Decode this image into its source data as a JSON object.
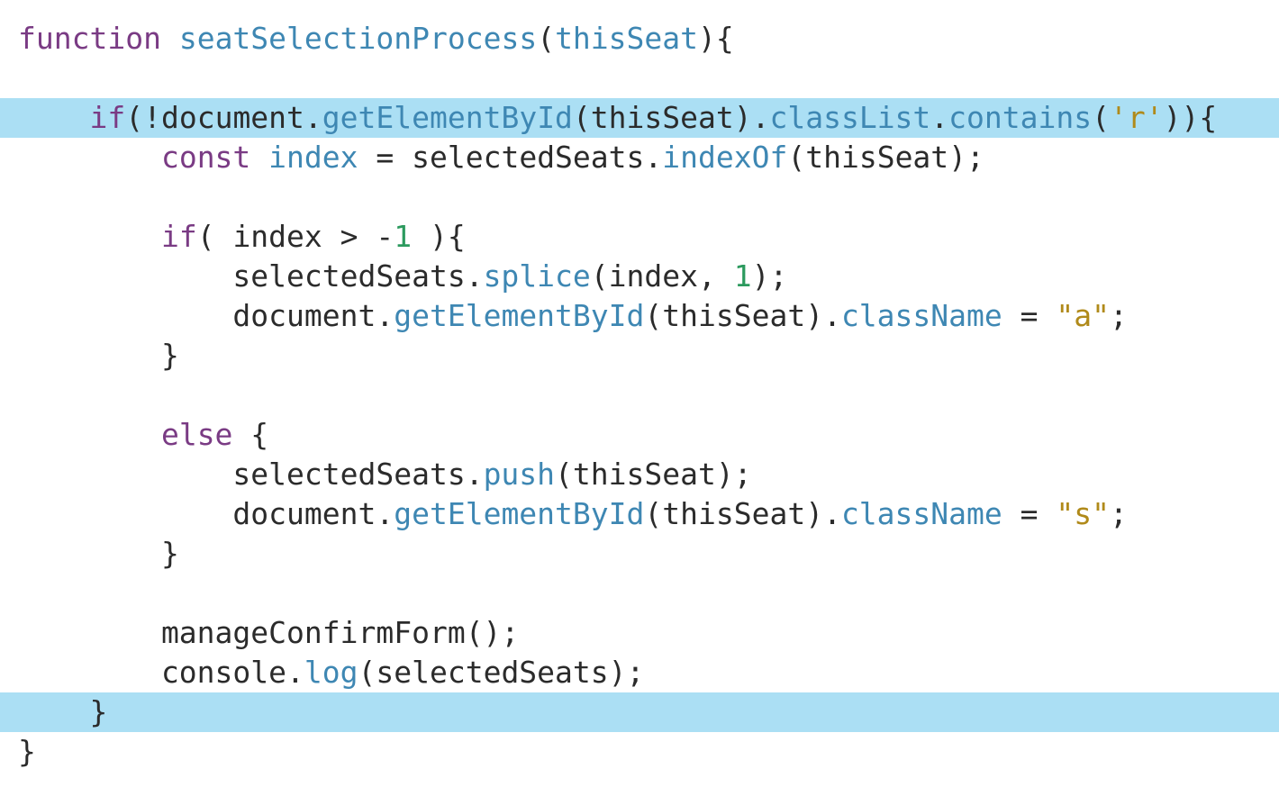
{
  "editor": {
    "colors": {
      "background": "#ffffff",
      "highlight": "#abdff4",
      "keyword": "#7a3b84",
      "method": "#3e87b3",
      "plain": "#2b2b2b",
      "string": "#b08a1a",
      "number": "#2c9a5e"
    },
    "lines": [
      {
        "highlighted": false,
        "tokens": [
          {
            "t": "keyword",
            "v": "function"
          },
          {
            "t": "plain",
            "v": " "
          },
          {
            "t": "method",
            "v": "seatSelectionProcess"
          },
          {
            "t": "plain",
            "v": "("
          },
          {
            "t": "method",
            "v": "thisSeat"
          },
          {
            "t": "plain",
            "v": "){"
          }
        ]
      },
      {
        "highlighted": false,
        "tokens": []
      },
      {
        "highlighted": true,
        "tokens": [
          {
            "t": "plain",
            "v": "    "
          },
          {
            "t": "keyword",
            "v": "if"
          },
          {
            "t": "plain",
            "v": "(!document."
          },
          {
            "t": "method",
            "v": "getElementById"
          },
          {
            "t": "plain",
            "v": "(thisSeat)."
          },
          {
            "t": "method",
            "v": "classList"
          },
          {
            "t": "plain",
            "v": "."
          },
          {
            "t": "method",
            "v": "contains"
          },
          {
            "t": "plain",
            "v": "("
          },
          {
            "t": "string",
            "v": "'r'"
          },
          {
            "t": "plain",
            "v": ")){"
          }
        ]
      },
      {
        "highlighted": false,
        "tokens": [
          {
            "t": "plain",
            "v": "        "
          },
          {
            "t": "keyword",
            "v": "const"
          },
          {
            "t": "plain",
            "v": " "
          },
          {
            "t": "method",
            "v": "index"
          },
          {
            "t": "plain",
            "v": " = selectedSeats."
          },
          {
            "t": "method",
            "v": "indexOf"
          },
          {
            "t": "plain",
            "v": "(thisSeat);"
          }
        ]
      },
      {
        "highlighted": false,
        "tokens": []
      },
      {
        "highlighted": false,
        "tokens": [
          {
            "t": "plain",
            "v": "        "
          },
          {
            "t": "keyword",
            "v": "if"
          },
          {
            "t": "plain",
            "v": "( index > -"
          },
          {
            "t": "number",
            "v": "1"
          },
          {
            "t": "plain",
            "v": " ){"
          }
        ]
      },
      {
        "highlighted": false,
        "tokens": [
          {
            "t": "plain",
            "v": "            selectedSeats."
          },
          {
            "t": "method",
            "v": "splice"
          },
          {
            "t": "plain",
            "v": "(index, "
          },
          {
            "t": "number",
            "v": "1"
          },
          {
            "t": "plain",
            "v": ");"
          }
        ]
      },
      {
        "highlighted": false,
        "tokens": [
          {
            "t": "plain",
            "v": "            document."
          },
          {
            "t": "method",
            "v": "getElementById"
          },
          {
            "t": "plain",
            "v": "(thisSeat)."
          },
          {
            "t": "method",
            "v": "className"
          },
          {
            "t": "plain",
            "v": " = "
          },
          {
            "t": "string",
            "v": "\"a\""
          },
          {
            "t": "plain",
            "v": ";"
          }
        ]
      },
      {
        "highlighted": false,
        "tokens": [
          {
            "t": "plain",
            "v": "        }"
          }
        ]
      },
      {
        "highlighted": false,
        "tokens": []
      },
      {
        "highlighted": false,
        "tokens": [
          {
            "t": "plain",
            "v": "        "
          },
          {
            "t": "keyword",
            "v": "else"
          },
          {
            "t": "plain",
            "v": " {"
          }
        ]
      },
      {
        "highlighted": false,
        "tokens": [
          {
            "t": "plain",
            "v": "            selectedSeats."
          },
          {
            "t": "method",
            "v": "push"
          },
          {
            "t": "plain",
            "v": "(thisSeat);"
          }
        ]
      },
      {
        "highlighted": false,
        "tokens": [
          {
            "t": "plain",
            "v": "            document."
          },
          {
            "t": "method",
            "v": "getElementById"
          },
          {
            "t": "plain",
            "v": "(thisSeat)."
          },
          {
            "t": "method",
            "v": "className"
          },
          {
            "t": "plain",
            "v": " = "
          },
          {
            "t": "string",
            "v": "\"s\""
          },
          {
            "t": "plain",
            "v": ";"
          }
        ]
      },
      {
        "highlighted": false,
        "tokens": [
          {
            "t": "plain",
            "v": "        }"
          }
        ]
      },
      {
        "highlighted": false,
        "tokens": []
      },
      {
        "highlighted": false,
        "tokens": [
          {
            "t": "plain",
            "v": "        manageConfirmForm();"
          }
        ]
      },
      {
        "highlighted": false,
        "tokens": [
          {
            "t": "plain",
            "v": "        console."
          },
          {
            "t": "method",
            "v": "log"
          },
          {
            "t": "plain",
            "v": "(selectedSeats);"
          }
        ]
      },
      {
        "highlighted": true,
        "tokens": [
          {
            "t": "plain",
            "v": "    }"
          }
        ]
      },
      {
        "highlighted": false,
        "tokens": [
          {
            "t": "plain",
            "v": "}"
          }
        ]
      }
    ]
  }
}
